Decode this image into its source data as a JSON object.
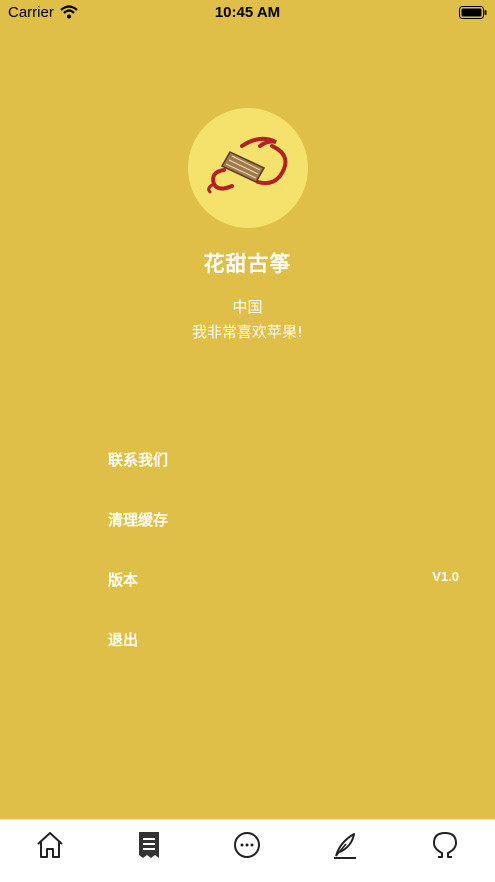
{
  "status_bar": {
    "carrier": "Carrier",
    "time": "10:45 AM"
  },
  "profile": {
    "name": "花甜古筝",
    "location": "中国",
    "motto": "我非常喜欢苹果!"
  },
  "menu": {
    "items": [
      {
        "label": "联系我们",
        "value": ""
      },
      {
        "label": "清理缓存",
        "value": ""
      },
      {
        "label": "版本",
        "value": "V1.0"
      },
      {
        "label": "退出",
        "value": ""
      }
    ]
  },
  "tab_bar": {
    "tabs": [
      {
        "icon": "home-icon"
      },
      {
        "icon": "document-icon"
      },
      {
        "icon": "chat-icon"
      },
      {
        "icon": "quill-icon"
      },
      {
        "icon": "profile-icon"
      }
    ]
  },
  "colors": {
    "background": "#DFBF48",
    "avatar": "#F4E26D",
    "accent_red": "#B22222",
    "tab_bar": "#FFFFFF"
  }
}
